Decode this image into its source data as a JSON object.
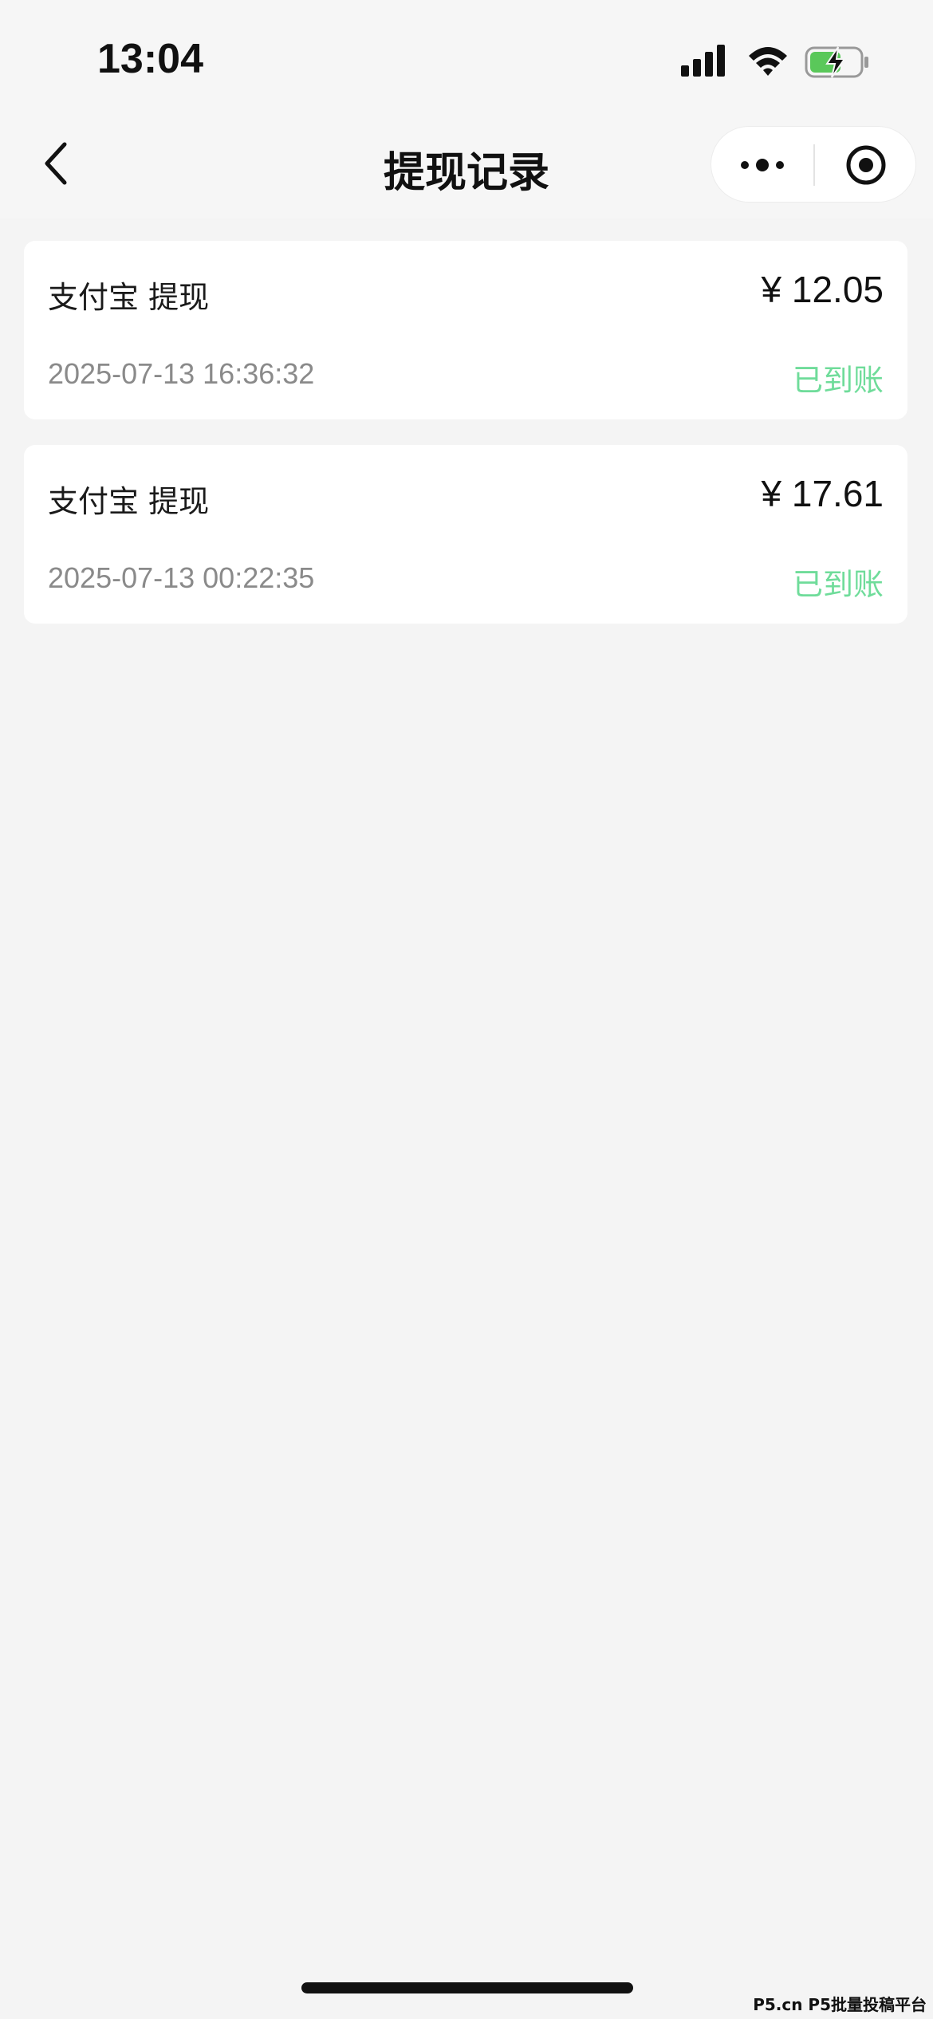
{
  "status_bar": {
    "time": "13:04",
    "icons": [
      "signal-icon",
      "wifi-icon",
      "battery-charging-icon"
    ],
    "battery_color": "#5ac85a"
  },
  "nav": {
    "title": "提现记录",
    "back_icon": "chevron-left-icon",
    "more_icon": "more-dots-icon",
    "close_icon": "target-circle-icon"
  },
  "records": [
    {
      "title": "支付宝 提现",
      "amount": "¥ 12.05",
      "time": "2025-07-13 16:36:32",
      "status": "已到账"
    },
    {
      "title": "支付宝 提现",
      "amount": "¥ 17.61",
      "time": "2025-07-13 00:22:35",
      "status": "已到账"
    }
  ],
  "colors": {
    "background": "#f4f4f4",
    "card": "#ffffff",
    "status_green": "#6fdc9a",
    "secondary_text": "#8a8a8a"
  },
  "watermark": "P5.cn P5批量投稿平台"
}
